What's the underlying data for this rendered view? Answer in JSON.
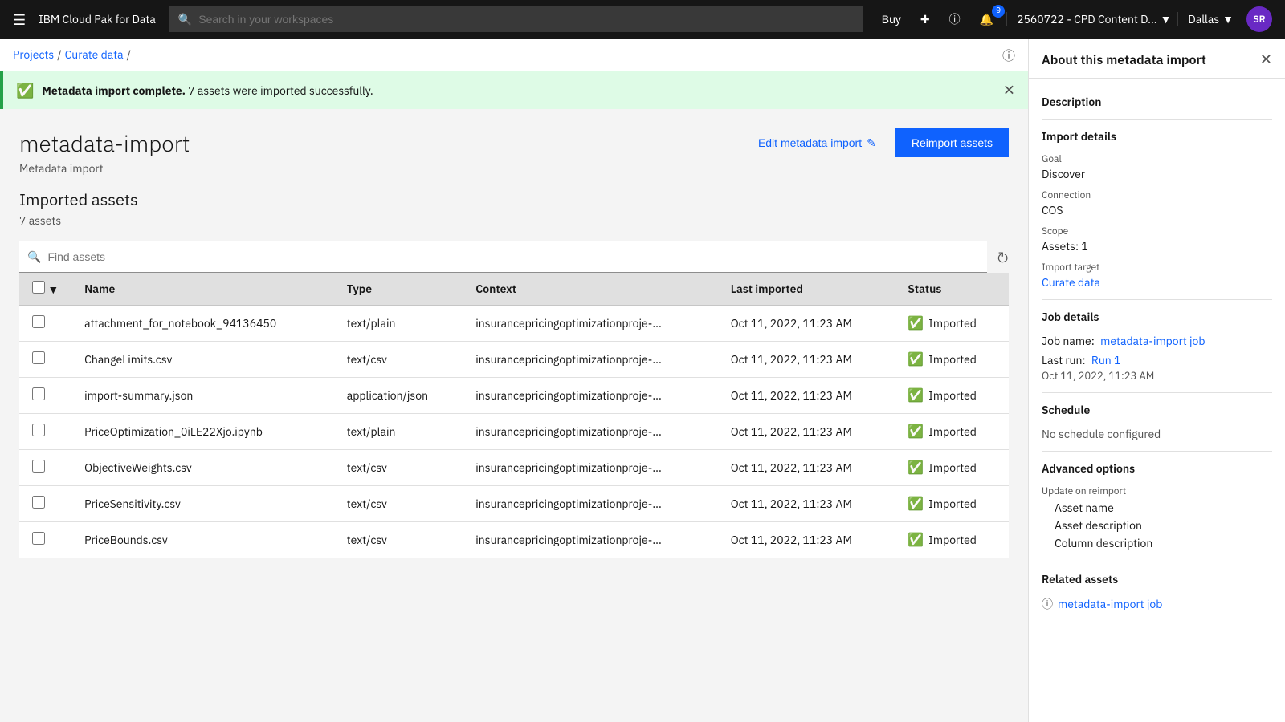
{
  "app": {
    "brand": "IBM Cloud Pak for Data"
  },
  "topnav": {
    "search_placeholder": "Search in your workspaces",
    "buy_label": "Buy",
    "account": "2560722 - CPD Content D...",
    "region": "Dallas",
    "avatar_initials": "SR",
    "notification_count": "9"
  },
  "breadcrumb": {
    "items": [
      "Projects",
      "Curate data",
      ""
    ]
  },
  "alert": {
    "message": "Metadata import complete.",
    "detail": " 7 assets were imported successfully."
  },
  "page": {
    "title": "metadata-import",
    "subtitle": "Metadata import",
    "edit_label": "Edit metadata import",
    "reimport_label": "Reimport assets"
  },
  "assets": {
    "section_title": "Imported assets",
    "count_label": "7 assets",
    "search_placeholder": "Find assets"
  },
  "table": {
    "columns": [
      "Name",
      "Type",
      "Context",
      "Last imported",
      "Status"
    ],
    "rows": [
      {
        "name": "attachment_for_notebook_94136450",
        "type": "text/plain",
        "context": "insurancepricingoptimizationproje-...",
        "last_imported": "Oct 11, 2022, 11:23 AM",
        "status": "Imported"
      },
      {
        "name": "ChangeLimits.csv",
        "type": "text/csv",
        "context": "insurancepricingoptimizationproje-...",
        "last_imported": "Oct 11, 2022, 11:23 AM",
        "status": "Imported"
      },
      {
        "name": "import-summary.json",
        "type": "application/json",
        "context": "insurancepricingoptimizationproje-...",
        "last_imported": "Oct 11, 2022, 11:23 AM",
        "status": "Imported"
      },
      {
        "name": "PriceOptimization_0iLE22Xjo.ipynb",
        "type": "text/plain",
        "context": "insurancepricingoptimizationproje-...",
        "last_imported": "Oct 11, 2022, 11:23 AM",
        "status": "Imported"
      },
      {
        "name": "ObjectiveWeights.csv",
        "type": "text/csv",
        "context": "insurancepricingoptimizationproje-...",
        "last_imported": "Oct 11, 2022, 11:23 AM",
        "status": "Imported"
      },
      {
        "name": "PriceSensitivity.csv",
        "type": "text/csv",
        "context": "insurancepricingoptimizationproje-...",
        "last_imported": "Oct 11, 2022, 11:23 AM",
        "status": "Imported"
      },
      {
        "name": "PriceBounds.csv",
        "type": "text/csv",
        "context": "insurancepricingoptimizationproje-...",
        "last_imported": "Oct 11, 2022, 11:23 AM",
        "status": "Imported"
      }
    ]
  },
  "right_panel": {
    "title": "About this metadata import",
    "sections": {
      "description": {
        "label": "Description",
        "value": ""
      },
      "import_details": {
        "label": "Import details",
        "goal_label": "Goal",
        "goal_value": "Discover",
        "connection_label": "Connection",
        "connection_value": "COS",
        "scope_label": "Scope",
        "scope_value": "Assets: 1",
        "import_target_label": "Import target",
        "import_target_value": "Curate data"
      },
      "job_details": {
        "label": "Job details",
        "job_name_label": "Job name:",
        "job_name_value": "metadata-import job",
        "last_run_label": "Last run:",
        "last_run_value": "Run 1",
        "last_run_date": "Oct 11, 2022, 11:23 AM"
      },
      "schedule": {
        "label": "Schedule",
        "value": "No schedule configured"
      },
      "advanced_options": {
        "label": "Advanced options",
        "update_label": "Update on reimport",
        "items": [
          "Asset name",
          "Asset description",
          "Column description"
        ]
      },
      "related_assets": {
        "label": "Related assets",
        "items": [
          "metadata-import job"
        ]
      }
    }
  }
}
